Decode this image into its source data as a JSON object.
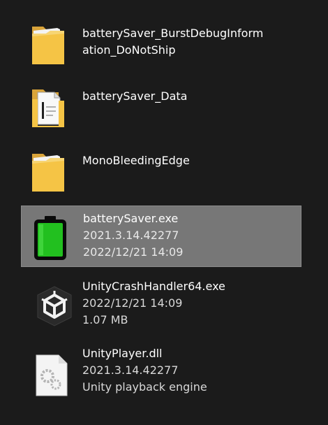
{
  "files": [
    {
      "name": "batterySaver_BurstDebugInform\nation_DoNotShip",
      "name_line1": "batterySaver_BurstDebugInform",
      "name_line2": "ation_DoNotShip",
      "icon": "folder-icon"
    },
    {
      "name_line1": "batterySaver_Data",
      "icon": "folder-document-icon"
    },
    {
      "name_line1": "MonoBleedingEdge",
      "icon": "folder-icon"
    },
    {
      "name_line1": "batterySaver.exe",
      "version": "2021.3.14.42277",
      "modified": "2022/12/21 14:09",
      "icon": "battery-icon",
      "selected": true
    },
    {
      "name_line1": "UnityCrashHandler64.exe",
      "modified": "2022/12/21 14:09",
      "size": "1.07 MB",
      "icon": "unity-logo-icon"
    },
    {
      "name_line1": "UnityPlayer.dll",
      "version": "2021.3.14.42277",
      "description": "Unity playback engine",
      "icon": "dll-gears-icon"
    }
  ],
  "colors": {
    "background": "#1b1b1b",
    "selection": "#777777",
    "folder": "#f5c445",
    "battery_fill": "#22c01f"
  }
}
